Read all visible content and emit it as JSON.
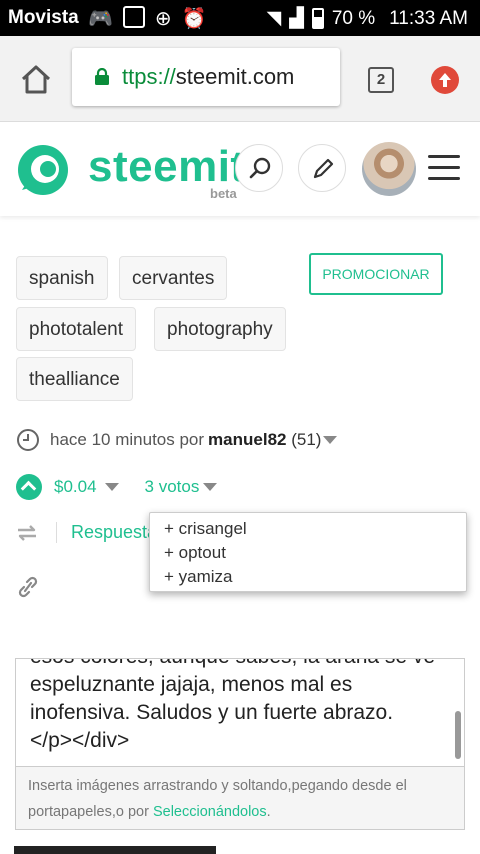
{
  "status": {
    "carrier": "Movista",
    "battery": "70 %",
    "time": "11:33 AM"
  },
  "browser": {
    "url_proto": "ttps://",
    "url_host": "steemit.com",
    "tab_count": "2"
  },
  "header": {
    "logo": "steemit",
    "beta": "beta"
  },
  "tags": [
    "spanish",
    "cervantes",
    "phototalent",
    "photography",
    "thealliance"
  ],
  "promote_label": "PROMOCIONAR",
  "post": {
    "time_text": "hace 10 minutos por",
    "author": "manuel82",
    "reputation": "(51)",
    "payout": "$0.04",
    "votes": "3 votos",
    "reply_label": "Respuesta"
  },
  "voters": [
    "+ crisangel",
    "+ optout",
    "+ yamiza"
  ],
  "editor": {
    "lines": [
      "esos colores, aunque sabes, la araña se ve",
      "espeluznante jajaja, menos mal es",
      "inofensiva. Saludos y un fuerte abrazo.",
      "</p></div>"
    ],
    "hint_text": "Inserta imágenes arrastrando y soltando,pegando desde el portapapeles,o por",
    "hint_link": "Seleccionándolos",
    "hint_end": "."
  },
  "colors": {
    "accent": "#1fbf8f",
    "update": "#e0493a"
  }
}
